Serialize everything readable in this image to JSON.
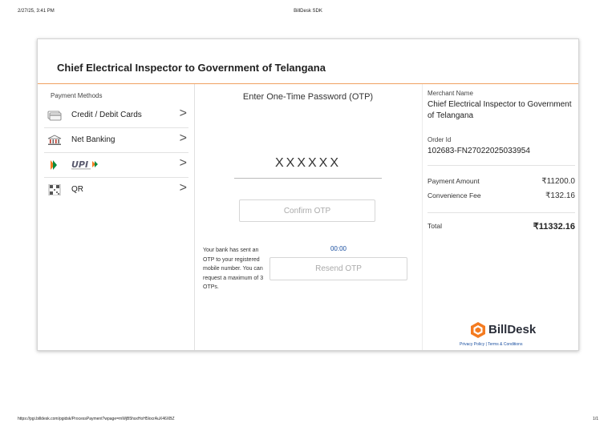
{
  "print": {
    "datetime": "2/27/25, 3:41 PM",
    "title": "BillDesk SDK",
    "url": "https://pgi.billdesk.com/pgidsk/ProcessPayment?wpage=mWjB5hsxHoH5locrAuX46XBZ",
    "page": "1/1"
  },
  "card": {
    "title": "Chief Electrical Inspector to Government of Telangana"
  },
  "payment_methods": {
    "heading": "Payment Methods",
    "items": [
      {
        "label": "Credit / Debit Cards",
        "icon": "card-icon"
      },
      {
        "label": "Net Banking",
        "icon": "bank-icon"
      },
      {
        "label": "",
        "icon": "upi-logo"
      },
      {
        "label": "QR",
        "icon": "qr-icon"
      }
    ],
    "chevron": ">"
  },
  "otp": {
    "heading": "Enter One-Time Password (OTP)",
    "value": "XXXXXX",
    "confirm_label": "Confirm OTP",
    "bank_note": "Your bank has sent an OTP to your registered mobile number. You can request a maximum of 3 OTPs.",
    "timer": "00:00",
    "resend_label": "Resend OTP"
  },
  "merchant": {
    "name_label": "Merchant Name",
    "name_value": "Chief Electrical Inspector to Government of Telangana",
    "order_label": "Order Id",
    "order_value": "102683-FN27022025033954",
    "payment_amount_label": "Payment Amount",
    "payment_amount_value": "₹11200.0",
    "convenience_fee_label": "Convenience Fee",
    "convenience_fee_value": "₹132.16",
    "total_label": "Total",
    "total_value": "₹11332.16"
  },
  "brand": {
    "name": "BillDesk",
    "links": "Privacy Policy | Terms & Conditions",
    "accent": "#f47b20"
  }
}
